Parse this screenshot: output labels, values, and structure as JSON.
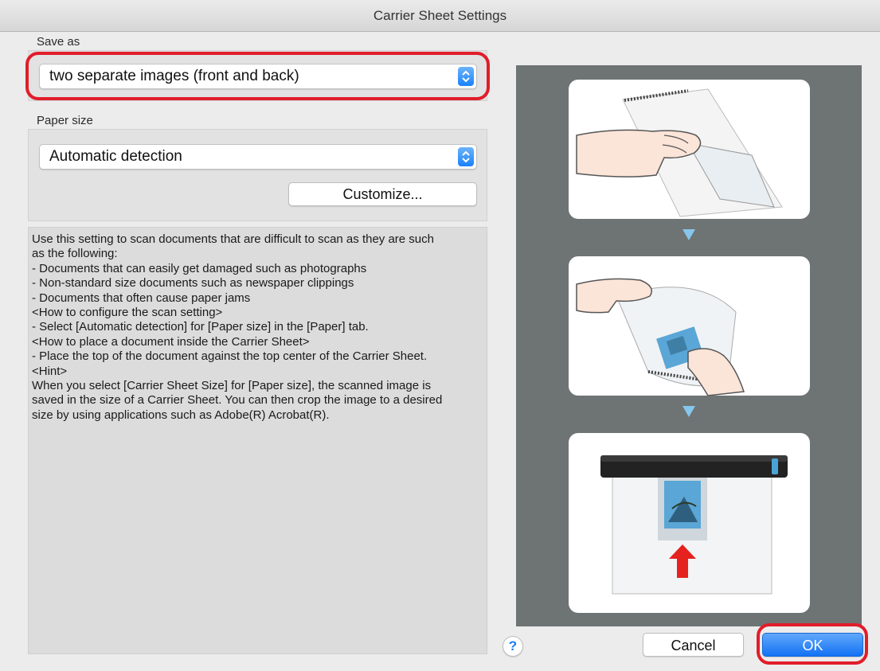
{
  "window": {
    "title": "Carrier Sheet Settings"
  },
  "save_as": {
    "label": "Save as",
    "selected": "two separate images (front and back)"
  },
  "paper_size": {
    "label": "Paper size",
    "selected": "Automatic detection",
    "customize_label": "Customize..."
  },
  "description": {
    "lines": [
      "Use this setting to scan documents that are difficult to scan as they are such",
      "as the following:",
      "- Documents that can easily get damaged such as photographs",
      "- Non-standard size documents such as newspaper clippings",
      "- Documents that often cause paper jams",
      "",
      "<How to configure the scan setting>",
      "- Select [Automatic detection] for [Paper size] in the [Paper] tab.",
      "",
      "<How to place a document inside the Carrier Sheet>",
      "- Place the top of the document against the top center of the Carrier Sheet.",
      "",
      "<Hint>",
      "When you select [Carrier Sheet Size] for [Paper size], the scanned image is",
      "saved in the size of a Carrier Sheet. You can then crop the image to a desired",
      "size by using applications such as Adobe(R) Acrobat(R)."
    ]
  },
  "buttons": {
    "help": "?",
    "cancel": "Cancel",
    "ok": "OK"
  },
  "colors": {
    "highlight": "#e11d2a",
    "accent": "#1272f4",
    "preview_bg": "#6e7373",
    "arrow": "#86c6ec"
  }
}
